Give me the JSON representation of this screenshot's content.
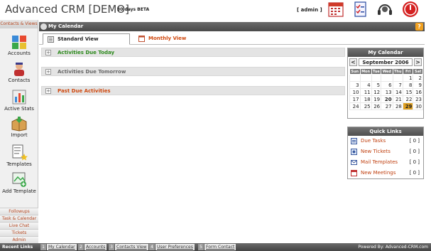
{
  "header": {
    "title": "Advanced CRM [DEMO]",
    "subtitle": "30 days BETA",
    "user": "[ admin ]"
  },
  "sidebar": {
    "heading": "Contacts & Views",
    "items": [
      {
        "label": "Accounts",
        "icon": "accounts-icon"
      },
      {
        "label": "Contacts",
        "icon": "contacts-icon"
      },
      {
        "label": "Active Stats",
        "icon": "stats-icon"
      },
      {
        "label": "Import",
        "icon": "import-icon"
      },
      {
        "label": "Templates",
        "icon": "templates-icon"
      },
      {
        "label": "Add Template",
        "icon": "add-template-icon"
      }
    ],
    "bottom_links": [
      "Followups",
      "Task & Calendar",
      "Live Chat",
      "Tickets",
      "Admin"
    ]
  },
  "main": {
    "title": "My Calendar",
    "tabs": [
      {
        "label": "Standard View",
        "active": true
      },
      {
        "label": "Monthly View",
        "active": false
      }
    ],
    "sections": [
      {
        "label": "Activities Due Today",
        "color": "#2e8a1e"
      },
      {
        "label": "Activities Due Tomorrow",
        "color": "#6a6a6a"
      },
      {
        "label": "Past Due Activities",
        "color": "#d04a10"
      }
    ]
  },
  "calendar": {
    "heading": "My Calendar",
    "prev": "<",
    "next": ">",
    "month": "September 2006",
    "days": [
      "Sun",
      "Mon",
      "Tue",
      "Wed",
      "Thu",
      "Fri",
      "Sat"
    ],
    "weeks": [
      [
        "",
        "",
        "",
        "",
        "",
        "1",
        "2"
      ],
      [
        "3",
        "4",
        "5",
        "6",
        "7",
        "8",
        "9"
      ],
      [
        "10",
        "11",
        "12",
        "13",
        "14",
        "15",
        "16"
      ],
      [
        "17",
        "18",
        "19",
        "20",
        "21",
        "22",
        "23"
      ],
      [
        "24",
        "25",
        "26",
        "27",
        "28",
        "29",
        "30"
      ]
    ],
    "today": "29",
    "bold_days": [
      "20"
    ]
  },
  "quick_links": {
    "heading": "Quick Links",
    "items": [
      {
        "label": "Due Tasks",
        "count": "[ 0 ]"
      },
      {
        "label": "New Tickets",
        "count": "[ 0 ]"
      },
      {
        "label": "Mail Templates",
        "count": "[ 0 ]"
      },
      {
        "label": "New Meetings",
        "count": "[ 0 ]"
      }
    ]
  },
  "footer": {
    "label": "Recent Links",
    "links": [
      {
        "num": "1",
        "label": "My Calendar"
      },
      {
        "num": "2",
        "label": "Accounts"
      },
      {
        "num": "3",
        "label": "Contacts View"
      },
      {
        "num": "4",
        "label": "User Preferences"
      },
      {
        "num": "5",
        "label": "Form Contact"
      }
    ],
    "powered": "Powered By: Advanced-CRM.com"
  }
}
